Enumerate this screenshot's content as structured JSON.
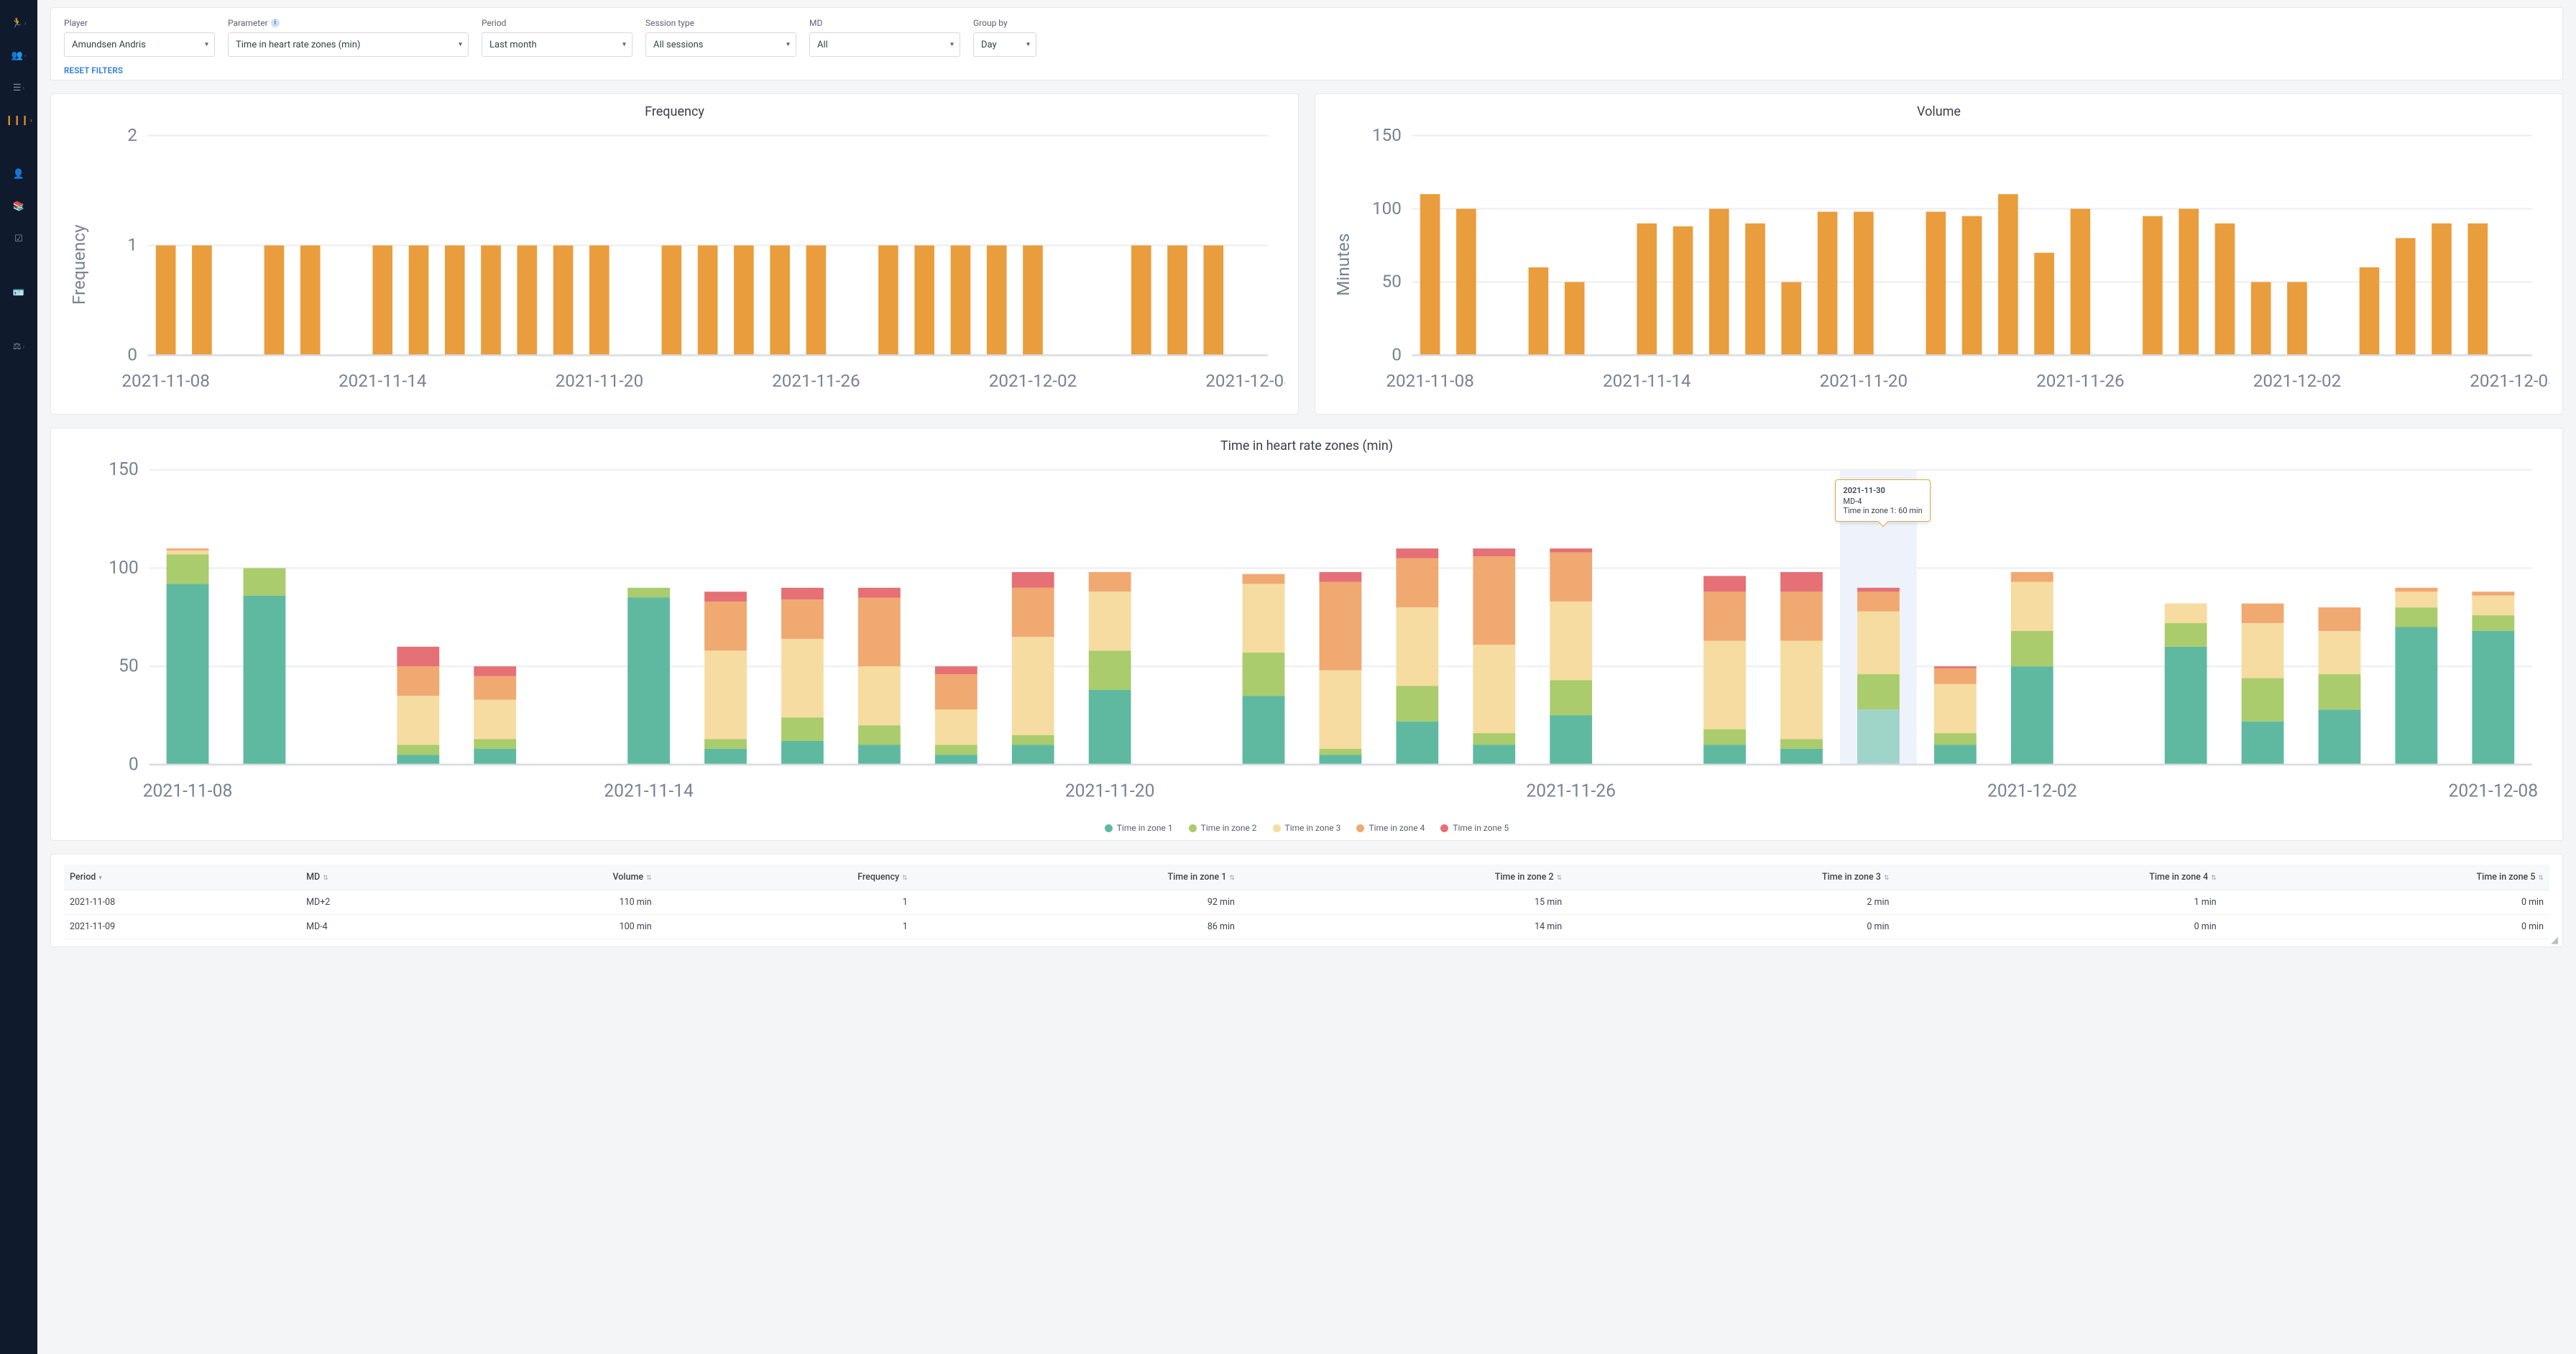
{
  "sidenav": {
    "items": [
      {
        "name": "run-icon",
        "active": false
      },
      {
        "name": "people-icon",
        "active": false
      },
      {
        "name": "list-icon",
        "active": false
      },
      {
        "name": "bars-icon",
        "active": true
      },
      {
        "name": "user-icon",
        "active": false
      },
      {
        "name": "books-icon",
        "active": false
      },
      {
        "name": "checklist-icon",
        "active": false
      },
      {
        "name": "id-icon",
        "active": false
      },
      {
        "name": "balance-icon",
        "active": false
      }
    ]
  },
  "filters": {
    "player": {
      "label": "Player",
      "value": "Amundsen Andris"
    },
    "parameter": {
      "label": "Parameter",
      "value": "Time in heart rate zones (min)"
    },
    "period": {
      "label": "Period",
      "value": "Last month"
    },
    "session_type": {
      "label": "Session type",
      "value": "All sessions"
    },
    "md": {
      "label": "MD",
      "value": "All"
    },
    "group_by": {
      "label": "Group by",
      "value": "Day"
    },
    "reset": "RESET FILTERS"
  },
  "charts": {
    "frequency": {
      "title": "Frequency",
      "ylabel": "Frequency",
      "ylim": [
        0,
        2
      ]
    },
    "volume": {
      "title": "Volume",
      "ylabel": "Minutes",
      "ylim": [
        0,
        150
      ]
    },
    "zones": {
      "title": "Time in heart rate zones (min)",
      "ylim": [
        0,
        150
      ],
      "legend": [
        "Time in zone 1",
        "Time in zone 2",
        "Time in zone 3",
        "Time in zone 4",
        "Time in zone 5"
      ],
      "tooltip": {
        "date": "2021-11-30",
        "md": "MD-4",
        "line": "Time in zone 1: 60 min"
      }
    },
    "x_ticks": [
      "2021-11-08",
      "2021-11-14",
      "2021-11-20",
      "2021-11-26",
      "2021-12-02",
      "2021-12-08"
    ]
  },
  "chart_data": {
    "dates": [
      "2021-11-08",
      "2021-11-09",
      "2021-11-10",
      "2021-11-11",
      "2021-11-12",
      "2021-11-13",
      "2021-11-14",
      "2021-11-15",
      "2021-11-16",
      "2021-11-17",
      "2021-11-18",
      "2021-11-19",
      "2021-11-20",
      "2021-11-21",
      "2021-11-22",
      "2021-11-23",
      "2021-11-24",
      "2021-11-25",
      "2021-11-26",
      "2021-11-27",
      "2021-11-28",
      "2021-11-29",
      "2021-11-30",
      "2021-12-01",
      "2021-12-02",
      "2021-12-03",
      "2021-12-04",
      "2021-12-05",
      "2021-12-06",
      "2021-12-07",
      "2021-12-08"
    ],
    "frequency": [
      1,
      1,
      0,
      1,
      1,
      0,
      1,
      1,
      1,
      1,
      1,
      1,
      1,
      0,
      1,
      1,
      1,
      1,
      1,
      0,
      1,
      1,
      1,
      1,
      1,
      0,
      0,
      1,
      1,
      1,
      0
    ],
    "volume": [
      110,
      100,
      0,
      60,
      50,
      0,
      90,
      88,
      100,
      90,
      50,
      98,
      98,
      0,
      98,
      95,
      110,
      70,
      100,
      0,
      95,
      100,
      90,
      50,
      50,
      0,
      60,
      80,
      90,
      90,
      0
    ],
    "zones": {
      "z1": [
        92,
        86,
        0,
        5,
        8,
        0,
        85,
        8,
        12,
        10,
        5,
        10,
        38,
        0,
        35,
        5,
        22,
        10,
        25,
        0,
        10,
        8,
        28,
        10,
        50,
        0,
        60,
        22,
        28,
        70,
        68,
        0
      ],
      "z2": [
        15,
        14,
        0,
        5,
        5,
        0,
        5,
        5,
        12,
        10,
        5,
        5,
        20,
        0,
        22,
        3,
        18,
        6,
        18,
        0,
        8,
        5,
        18,
        6,
        18,
        0,
        12,
        22,
        18,
        10,
        8,
        0
      ],
      "z3": [
        2,
        0,
        0,
        25,
        20,
        0,
        0,
        45,
        40,
        30,
        18,
        50,
        30,
        0,
        35,
        40,
        40,
        45,
        40,
        0,
        45,
        50,
        32,
        25,
        25,
        0,
        10,
        28,
        22,
        8,
        10,
        0
      ],
      "z4": [
        1,
        0,
        0,
        15,
        12,
        0,
        0,
        25,
        20,
        35,
        18,
        25,
        10,
        0,
        5,
        45,
        25,
        45,
        25,
        0,
        25,
        25,
        10,
        8,
        5,
        0,
        0,
        10,
        12,
        2,
        2,
        0
      ],
      "z5": [
        0,
        0,
        0,
        10,
        5,
        0,
        0,
        5,
        6,
        5,
        4,
        8,
        0,
        0,
        0,
        5,
        5,
        4,
        2,
        0,
        8,
        10,
        2,
        1,
        0,
        0,
        0,
        0,
        0,
        0,
        0,
        0
      ]
    }
  },
  "table": {
    "headers": [
      "Period",
      "MD",
      "Volume",
      "Frequency",
      "Time in zone 1",
      "Time in zone 2",
      "Time in zone 3",
      "Time in zone 4",
      "Time in zone 5"
    ],
    "rows": [
      {
        "period": "2021-11-08",
        "md": "MD+2",
        "volume": "110 min",
        "frequency": "1",
        "z1": "92 min",
        "z2": "15 min",
        "z3": "2 min",
        "z4": "1 min",
        "z5": "0 min"
      },
      {
        "period": "2021-11-09",
        "md": "MD-4",
        "volume": "100 min",
        "frequency": "1",
        "z1": "86 min",
        "z2": "14 min",
        "z3": "0 min",
        "z4": "0 min",
        "z5": "0 min"
      }
    ]
  }
}
